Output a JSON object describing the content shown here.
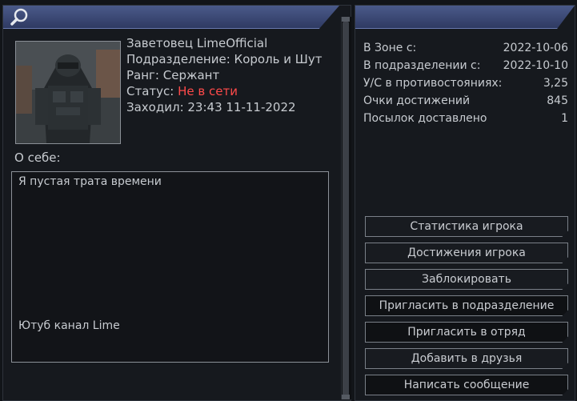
{
  "profile": {
    "name_line": "Заветовец LimeOfficial",
    "division_line": "Подразделение: Король и Шут",
    "rank_line": "Ранг: Сержант",
    "status_prefix": "Статус: ",
    "status_value": "Не в сети",
    "last_seen_line": "Заходил: 23:43 11-11-2022",
    "status_color": "#ff4a4a"
  },
  "about": {
    "label": "О себе:",
    "text": "Я пустая трата времени",
    "link": "Ютуб канал Lime"
  },
  "stats": [
    {
      "label": "В Зоне с:",
      "value": "2022-10-06"
    },
    {
      "label": "В подразделении с:",
      "value": "2022-10-10"
    },
    {
      "label": "У/С в противостояниях:",
      "value": "3,25"
    },
    {
      "label": "Очки достижений",
      "value": "845"
    },
    {
      "label": "Посылок доставлено",
      "value": "1"
    }
  ],
  "buttons": [
    {
      "label": "Статистика игрока"
    },
    {
      "label": "Достижения игрока"
    },
    {
      "label": "Заблокировать"
    },
    {
      "label": "Пригласить в подразделение"
    },
    {
      "label": "Пригласить в отряд"
    },
    {
      "label": "Добавить в друзья"
    },
    {
      "label": "Написать сообщение"
    }
  ],
  "icons": {
    "header_left": "search-icon"
  }
}
